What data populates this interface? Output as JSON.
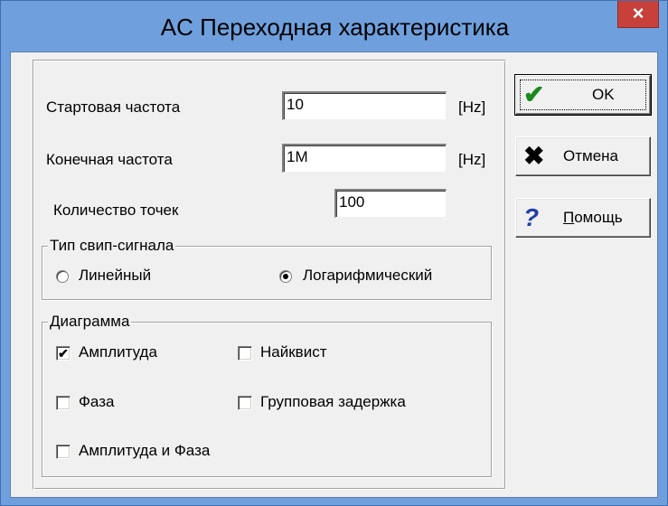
{
  "window": {
    "title": "AC Переходная характеристика",
    "close_glyph": "×"
  },
  "fields": {
    "start_freq": {
      "label": "Стартовая частота",
      "value": "10",
      "unit": "[Hz]"
    },
    "end_freq": {
      "label": "Конечная частота",
      "value": "1M",
      "unit": "[Hz]"
    },
    "points": {
      "label": "Количество точек",
      "value": "100"
    }
  },
  "sweep": {
    "title": "Тип свип-сигнала",
    "options": [
      {
        "label": "Линейный",
        "checked": false
      },
      {
        "label": "Логарифмический",
        "checked": true
      }
    ]
  },
  "diagram": {
    "title": "Диаграмма",
    "options": [
      {
        "label": "Амплитуда",
        "checked": true
      },
      {
        "label": "Найквист",
        "checked": false
      },
      {
        "label": "Фаза",
        "checked": false
      },
      {
        "label": "Групповая задержка",
        "checked": false
      },
      {
        "label": "Амплитуда и Фаза",
        "checked": false
      }
    ]
  },
  "buttons": {
    "ok": {
      "label": "OK",
      "icon": "checkmark-icon",
      "color": "#1a8a1a"
    },
    "cancel": {
      "label": "Отмена",
      "icon": "x-icon",
      "color": "#000000"
    },
    "help": {
      "label_underlined": "П",
      "label_rest": "омощь",
      "icon": "question-icon",
      "color": "#1f3fa6"
    }
  },
  "check_glyph": "✔"
}
